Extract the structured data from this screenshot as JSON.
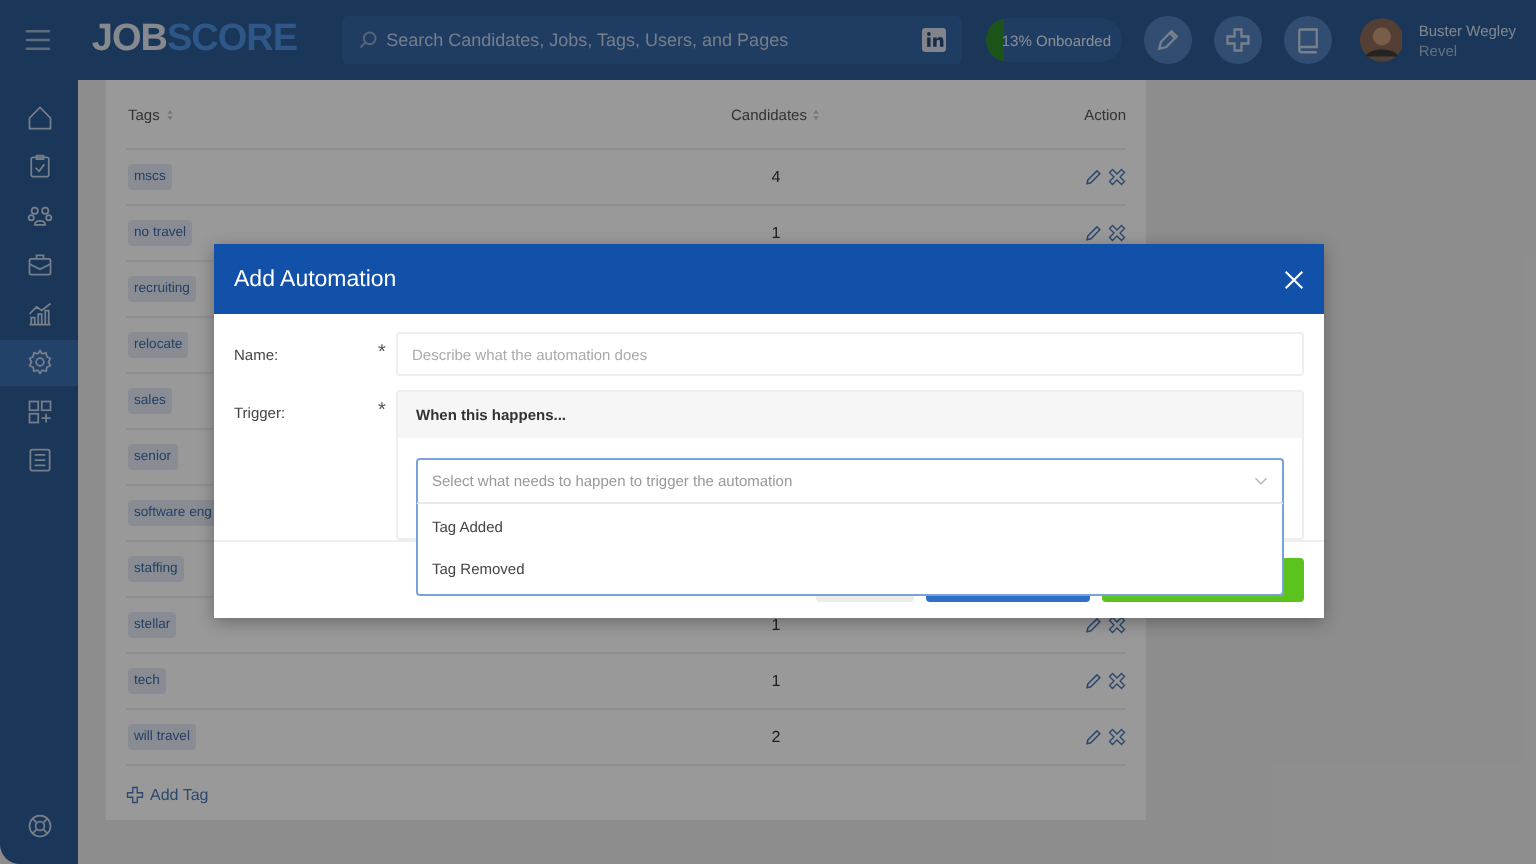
{
  "header": {
    "logo_left": "JOB",
    "logo_right": "SCORE",
    "search": {
      "placeholder": "Search Candidates, Jobs, Tags, Users, and Pages"
    },
    "onboarding": {
      "label": "13% Onboarded",
      "level": 0.13
    },
    "user": {
      "name": "Buster Wegley",
      "company": "Revel"
    }
  },
  "sidebar": {
    "items": [
      {
        "selected": false
      },
      {
        "selected": false
      },
      {
        "selected": false
      },
      {
        "selected": false
      },
      {
        "selected": false
      },
      {
        "selected": true
      },
      {
        "selected": false
      },
      {
        "selected": false
      }
    ]
  },
  "table": {
    "columns": [
      "Tags",
      "Candidates",
      "Action"
    ],
    "rows": [
      {
        "tag": "mscs",
        "count": "4"
      },
      {
        "tag": "no travel",
        "count": "1"
      },
      {
        "tag": "recruiting"
      },
      {
        "tag": "relocate"
      },
      {
        "tag": "sales"
      },
      {
        "tag": "senior"
      },
      {
        "tag": "software eng"
      },
      {
        "tag": "staffing"
      },
      {
        "tag": "stellar",
        "count": "1"
      },
      {
        "tag": "tech",
        "count": "1"
      },
      {
        "tag": "will travel",
        "count": "2"
      }
    ],
    "add_link": "Add Tag"
  },
  "modal": {
    "title": "Add Automation",
    "name_label": "Name:",
    "name_placeholder": "Describe what the automation does",
    "required_mark": "*",
    "trigger_label": "Trigger:",
    "trigger_heading": "When this happens...",
    "select_placeholder": "Select what needs to happen to trigger the automation",
    "options": [
      "Tag Added",
      "Tag Removed"
    ],
    "footer_buttons": [
      {
        "kind": "secondary"
      },
      {
        "kind": "primary"
      },
      {
        "kind": "success"
      }
    ]
  }
}
